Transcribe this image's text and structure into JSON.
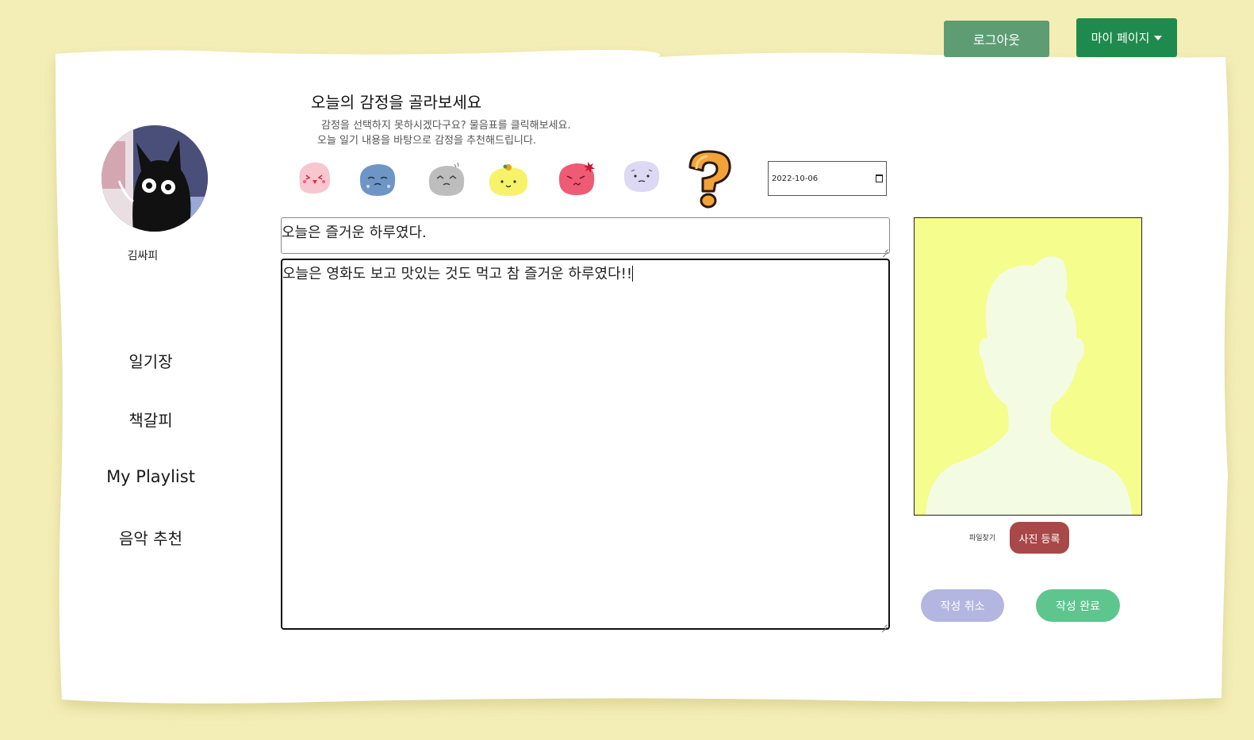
{
  "header": {
    "logout_label": "로그아웃",
    "mypage_label": "마이 페이지"
  },
  "profile": {
    "username": "김싸피"
  },
  "sidebar": {
    "items": [
      {
        "label": "일기장"
      },
      {
        "label": "책갈피"
      },
      {
        "label": "My Playlist"
      },
      {
        "label": "음악 추천"
      }
    ]
  },
  "emotion": {
    "title": "오늘의 감정을 골라보세요",
    "subtitle_line1": "감정을 선택하지 못하시겠다구요? 물음표를 클릭해보세요.",
    "subtitle_line2": "오늘 일기 내용을 바탕으로 감정을 추천해드립니다.",
    "options": [
      {
        "icon": "happy-blob-icon",
        "color": "#f7c6cf"
      },
      {
        "icon": "sad-blob-icon",
        "color": "#6f95c7"
      },
      {
        "icon": "annoyed-blob-icon",
        "color": "#bdbdbd"
      },
      {
        "icon": "joy-blob-icon",
        "color": "#f6f36a"
      },
      {
        "icon": "angry-blob-icon",
        "color": "#ef5a74"
      },
      {
        "icon": "worried-blob-icon",
        "color": "#ddd9f4"
      },
      {
        "icon": "question-mark-icon",
        "color": "#f3a23a"
      }
    ]
  },
  "diary": {
    "date": "2022-10-06",
    "title": "오늘은 즐거운 하루였다.",
    "body": "오늘은 영화도 보고 맛있는 것도 먹고 참 즐거운 하루였다!!"
  },
  "photo": {
    "file_find_label": "파일찾기",
    "register_label": "사진 등록"
  },
  "actions": {
    "cancel_label": "작성 취소",
    "done_label": "작성 완료"
  },
  "colors": {
    "background": "#f3eeb6",
    "logout": "#5e9c74",
    "mypage": "#1f8a4d",
    "register": "#a94848",
    "cancel": "#b3b6e0",
    "done": "#5ec58f",
    "photo_bg": "#f5fd8c"
  }
}
